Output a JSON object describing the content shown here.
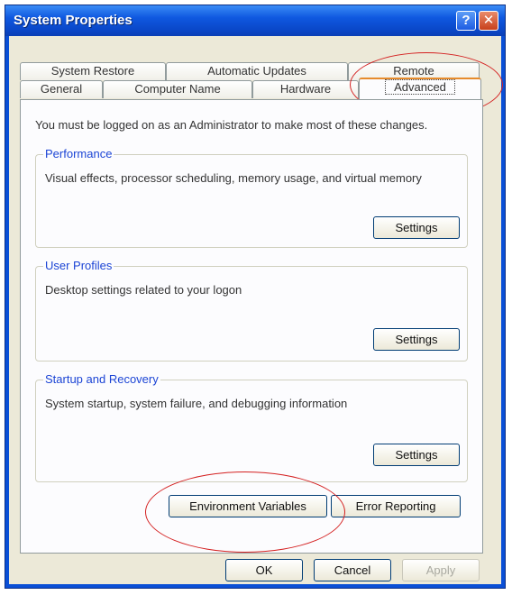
{
  "window": {
    "title": "System Properties"
  },
  "titlebar": {
    "help_label": "?",
    "close_label": "✕"
  },
  "tabs": {
    "row1": [
      "System Restore",
      "Automatic Updates",
      "Remote"
    ],
    "row2": [
      "General",
      "Computer Name",
      "Hardware",
      "Advanced"
    ]
  },
  "intro": "You must be logged on as an Administrator to make most of these changes.",
  "groups": {
    "performance": {
      "title": "Performance",
      "desc": "Visual effects, processor scheduling, memory usage, and virtual memory",
      "button": "Settings"
    },
    "user_profiles": {
      "title": "User Profiles",
      "desc": "Desktop settings related to your logon",
      "button": "Settings"
    },
    "startup": {
      "title": "Startup and Recovery",
      "desc": "System startup, system failure, and debugging information",
      "button": "Settings"
    }
  },
  "buttons": {
    "env": "Environment Variables",
    "error": "Error Reporting",
    "ok": "OK",
    "cancel": "Cancel",
    "apply": "Apply"
  },
  "colors": {
    "title_bar": "#0a4fd6",
    "accent_blue": "#1c45d5",
    "annotation_red": "#d42020"
  }
}
